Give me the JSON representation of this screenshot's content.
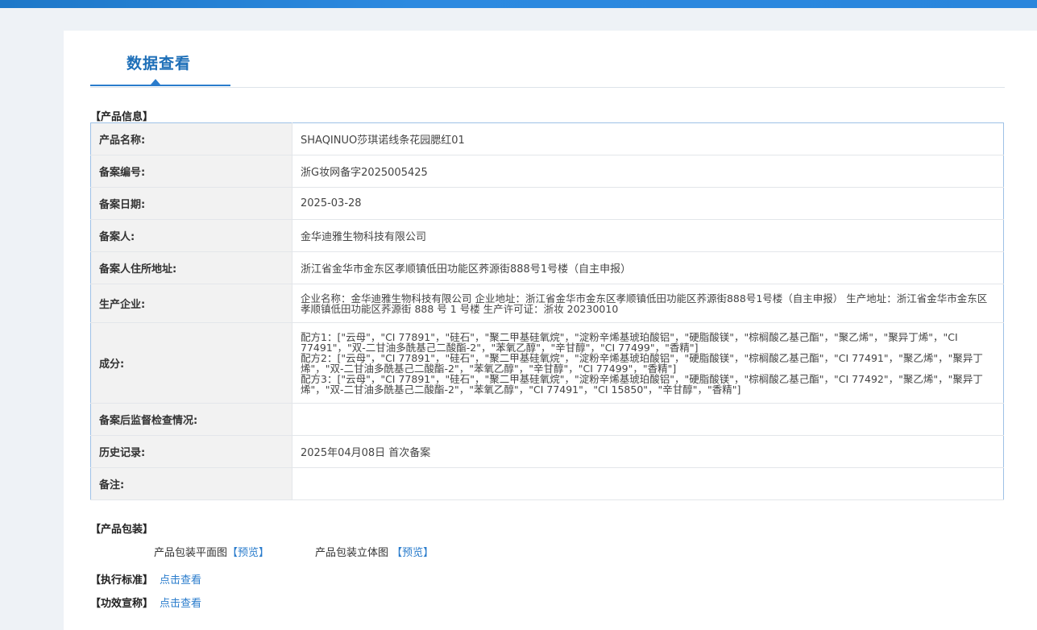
{
  "page_title": "数据查看",
  "sections": {
    "product_info": "【产品信息】",
    "product_package": "【产品包装】",
    "standard": "【执行标准】",
    "efficacy": "【功效宣称】"
  },
  "rows": [
    {
      "key": "产品名称:",
      "value": "SHAQINUO莎琪诺线条花园腮红01"
    },
    {
      "key": "备案编号:",
      "value": "浙G妆网备字2025005425"
    },
    {
      "key": "备案日期:",
      "value": "2025-03-28"
    },
    {
      "key": "备案人:",
      "value": "金华迪雅生物科技有限公司"
    },
    {
      "key": "备案人住所地址:",
      "value": "浙江省金华市金东区孝顺镇低田功能区荞源街888号1号楼（自主申报）"
    },
    {
      "key": "生产企业:",
      "value": "企业名称：金华迪雅生物科技有限公司 企业地址：浙江省金华市金东区孝顺镇低田功能区荞源街888号1号楼（自主申报） 生产地址：浙江省金华市金东区孝顺镇低田功能区荞源街 888 号 1 号楼 生产许可证：浙妆 20230010"
    },
    {
      "key": "成分:",
      "value_lines": [
        "配方1：[\"云母\"，\"CI 77891\"，\"硅石\"，\"聚二甲基硅氧烷\"，\"淀粉辛烯基琥珀酸铝\"，\"硬脂酸镁\"，\"棕榈酸乙基己酯\"，\"聚乙烯\"，\"聚异丁烯\"，\"CI 77491\"，\"双-二甘油多酰基己二酸酯-2\"，\"苯氧乙醇\"，\"辛甘醇\"，\"CI 77499\"，\"香精\"]",
        "配方2：[\"云母\"，\"CI 77891\"，\"硅石\"，\"聚二甲基硅氧烷\"，\"淀粉辛烯基琥珀酸铝\"，\"硬脂酸镁\"，\"棕榈酸乙基己酯\"，\"CI 77491\"，\"聚乙烯\"，\"聚异丁烯\"，\"双-二甘油多酰基己二酸酯-2\"，\"苯氧乙醇\"，\"辛甘醇\"，\"CI 77499\"，\"香精\"]",
        "配方3：[\"云母\"，\"CI 77891\"，\"硅石\"，\"聚二甲基硅氧烷\"，\"淀粉辛烯基琥珀酸铝\"，\"硬脂酸镁\"，\"棕榈酸乙基己酯\"，\"CI 77492\"，\"聚乙烯\"，\"聚异丁烯\"，\"双-二甘油多酰基己二酸酯-2\"，\"苯氧乙醇\"，\"CI 77491\"，\"CI 15850\"，\"辛甘醇\"，\"香精\"]"
      ]
    },
    {
      "key": "备案后监督检查情况:",
      "value": ""
    },
    {
      "key": "历史记录:",
      "value": "2025年04月08日 首次备案"
    },
    {
      "key": "备注:",
      "value": ""
    }
  ],
  "package": {
    "flat_label": "产品包装平面图",
    "flat_link": "【预览】",
    "solid_label": "产品包装立体图",
    "solid_link": "【预览】"
  },
  "standard_link": "点击查看",
  "efficacy_link": "点击查看",
  "colors": {
    "accent": "#2a7ccc",
    "title": "#1e6fb8",
    "key_bg": "#f2f2f2",
    "border": "#9ec1e6"
  }
}
